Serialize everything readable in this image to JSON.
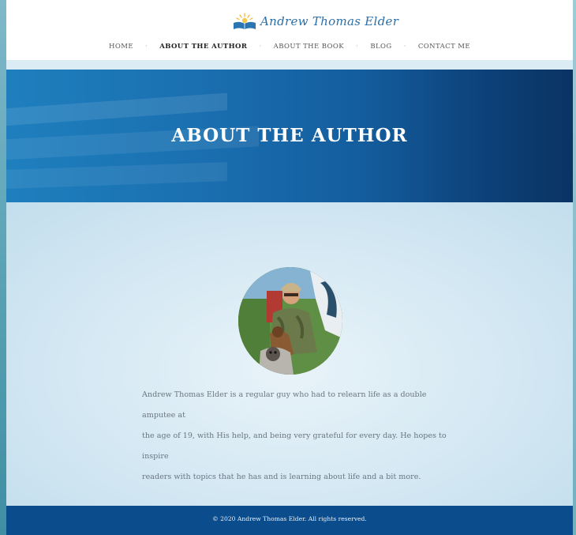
{
  "site": {
    "name": "Andrew Thomas Elder"
  },
  "nav": {
    "items": [
      {
        "label": "HOME"
      },
      {
        "label": "ABOUT THE AUTHOR"
      },
      {
        "label": "ABOUT THE BOOK"
      },
      {
        "label": "BLOG"
      },
      {
        "label": "CONTACT ME"
      }
    ],
    "separator": "·"
  },
  "hero": {
    "title": "ABOUT THE AUTHOR"
  },
  "bio": {
    "lines": [
      "Andrew Thomas Elder is a regular guy who had to relearn life as a double amputee at",
      "the age of 19, with His help, and being very grateful for every day. He hopes to inspire",
      "readers with topics that he has and is learning about life and a bit more."
    ]
  },
  "footer": {
    "text": "© 2020 Andrew Thomas Elder. All rights reserved."
  },
  "colors": {
    "brand_blue": "#2b6fa8",
    "hero_blue": "#1a6fb0",
    "footer_blue": "#0a4c8c"
  },
  "icons": {
    "logo": "open-book-sunrise-icon",
    "avatar": "author-photo"
  }
}
